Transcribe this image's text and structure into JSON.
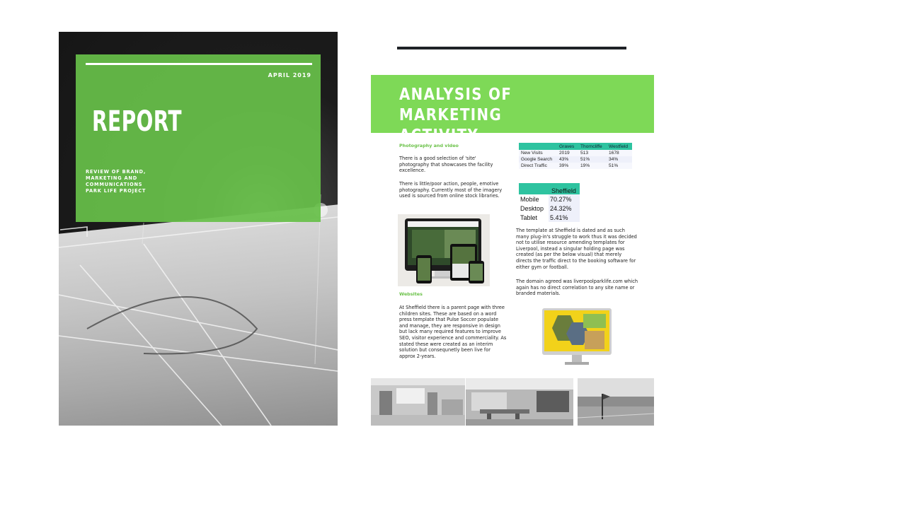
{
  "cover": {
    "date": "APRIL 2019",
    "title": "REPORT",
    "subtitle_lines": [
      "REVIEW OF BRAND,",
      "MARKETING AND",
      "COMMUNICATIONS",
      "PARK LIFE PROJECT"
    ]
  },
  "page": {
    "title_line1": "ANALYSIS OF MARKETING",
    "title_line2": "ACTIVITY",
    "photo_section": {
      "heading": "Photography and video",
      "para1": "There is a good selection of 'site' photography that showcases the facility excellence.",
      "para2": "There is little/poor action, people, emotive photography. Currently most of the imagery used is sourced from online stock libraries."
    },
    "websites_section": {
      "heading": "Websites",
      "para": "At Sheffield there is a parent page with three children sites. These are based on a word press template that Pulse Soccer populate and manage, they are responsive in design but lack many required features to improve SEO, visitor experience and commerciality. As stated these were created as an interim solution but consequnetly been live for approx 2-years."
    },
    "table1": {
      "headers": [
        "",
        "Graves",
        "Thorncliffe",
        "Westfield"
      ],
      "rows": [
        [
          "New Visits",
          "2019",
          "513",
          "1678"
        ],
        [
          "Google Search",
          "43%",
          "51%",
          "34%"
        ],
        [
          "Direct Traffic",
          "39%",
          "19%",
          "51%"
        ]
      ]
    },
    "table2": {
      "header": "Sheffield",
      "rows": [
        [
          "Mobile",
          "70.27%"
        ],
        [
          "Desktop",
          "24.32%"
        ],
        [
          "Tablet",
          "5.41%"
        ]
      ]
    },
    "right_para": "The template at Sheffield is dated and as such many plug-in's struggle to work thus it was decided not to utilise resource amending templates for Liverpool, instead a singular holding page was created (as per the below visual) that merely directs the traffic direct to the booking software for either gym or football.",
    "right_para2": "The domain agreed was liverpoolparklife.com which again has no direct correlation to any site name or branded materials."
  },
  "colors": {
    "cover_green": "#67c049",
    "header_green": "#7ed957",
    "table_teal": "#2ec3a0"
  }
}
